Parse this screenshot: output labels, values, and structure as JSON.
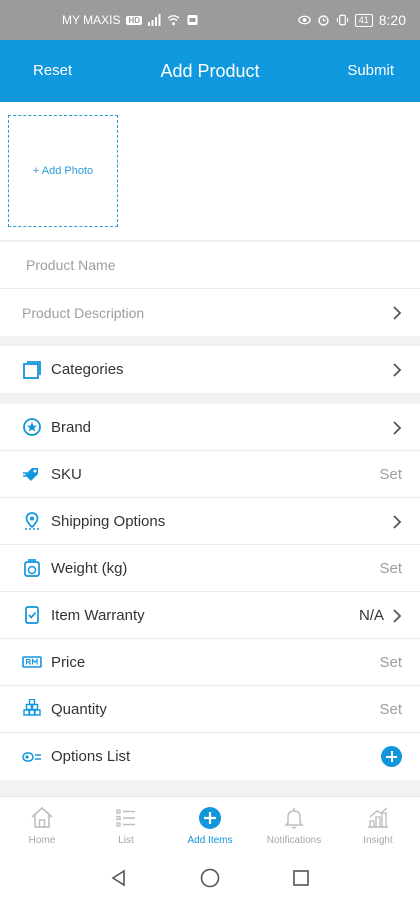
{
  "status_bar": {
    "carrier": "MY MAXIS",
    "network_badge": "HD",
    "battery": "41",
    "time": "8:20"
  },
  "header": {
    "reset_label": "Reset",
    "title": "Add Product",
    "submit_label": "Submit"
  },
  "photo": {
    "add_photo_label": "+ Add Photo"
  },
  "fields": {
    "product_name_placeholder": "Product Name",
    "product_description_placeholder": "Product Description"
  },
  "rows": {
    "categories": {
      "label": "Categories",
      "icon": "categories-icon"
    },
    "brand": {
      "label": "Brand",
      "icon": "star-badge-icon"
    },
    "sku": {
      "label": "SKU",
      "value": "Set",
      "icon": "sku-icon"
    },
    "shipping": {
      "label": "Shipping Options",
      "icon": "location-pin-icon"
    },
    "weight": {
      "label": "Weight (kg)",
      "value": "Set",
      "icon": "scale-icon"
    },
    "warranty": {
      "label": "Item Warranty",
      "value": "N/A",
      "icon": "warranty-icon"
    },
    "price": {
      "label": "Price",
      "value": "Set",
      "icon": "rm-price-icon"
    },
    "quantity": {
      "label": "Quantity",
      "value": "Set",
      "icon": "boxes-icon"
    },
    "options_list": {
      "label": "Options List",
      "icon": "options-list-icon"
    }
  },
  "bottom_nav": {
    "items": [
      {
        "label": "Home",
        "icon": "home-icon"
      },
      {
        "label": "List",
        "icon": "list-icon"
      },
      {
        "label": "Add Items",
        "icon": "add-circle-icon"
      },
      {
        "label": "Notifications",
        "icon": "bell-icon"
      },
      {
        "label": "Insight",
        "icon": "insight-icon"
      }
    ],
    "active_index": 2
  },
  "colors": {
    "brand_blue": "#0f98de",
    "status_bar": "#9b9b9b",
    "muted_text": "#9e9e9e"
  }
}
